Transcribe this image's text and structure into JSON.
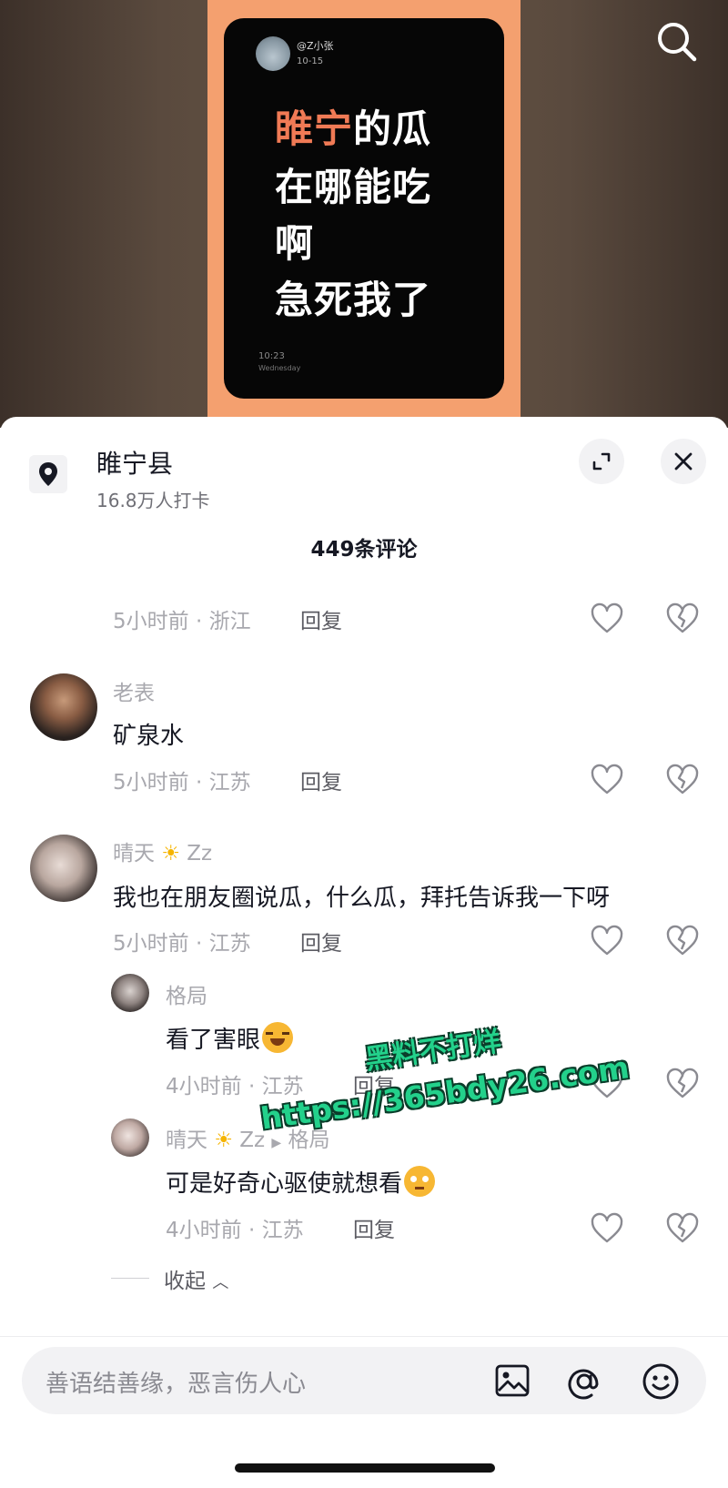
{
  "video": {
    "card_user": "@Z小张",
    "card_date": "10-15",
    "card_lines": [
      {
        "highlight": "睢宁",
        "rest": "的瓜"
      },
      {
        "highlight": "",
        "rest": "在哪能吃"
      },
      {
        "highlight": "",
        "rest": "啊"
      },
      {
        "highlight": "",
        "rest": "急死我了"
      }
    ],
    "card_time": "10:23",
    "card_day": "Wednesday"
  },
  "location": {
    "name": "睢宁县",
    "checkins": "16.8万人打卡"
  },
  "comments_header": "449条评论",
  "comments": [
    {
      "meta": "5小时前 · 浙江",
      "reply": "回复"
    },
    {
      "user": "老表",
      "text": "矿泉水",
      "meta": "5小时前 · 江苏",
      "reply": "回复"
    },
    {
      "user": "晴天",
      "user_suffix": "Zz",
      "text": "我也在朋友圈说瓜，什么瓜，拜托告诉我一下呀",
      "meta": "5小时前 · 江苏",
      "reply": "回复"
    }
  ],
  "replies": [
    {
      "user": "格局",
      "text": "看了害眼",
      "meta": "4小时前 · 江苏",
      "reply": "回复"
    },
    {
      "user": "晴天",
      "user_suffix": "Zz",
      "reply_to": "格局",
      "text": "可是好奇心驱使就想看",
      "meta": "4小时前 · 江苏",
      "reply": "回复"
    }
  ],
  "collapse_label": "收起",
  "input": {
    "placeholder": "善语结善缘，恶言伤人心"
  },
  "watermark": {
    "line1": "黑料不打烊",
    "line2": "https://365bdy26.com"
  },
  "colors": {
    "accent_orange": "#f07a55",
    "poster_bg": "#f4a06f",
    "watermark_green": "#23d18b"
  },
  "icons": [
    "search-icon",
    "location-pin-icon",
    "expand-icon",
    "close-icon",
    "heart-icon",
    "broken-heart-icon",
    "image-icon",
    "at-icon",
    "emoji-icon",
    "sun-icon",
    "chevron-up-icon",
    "play-arrow-icon"
  ]
}
